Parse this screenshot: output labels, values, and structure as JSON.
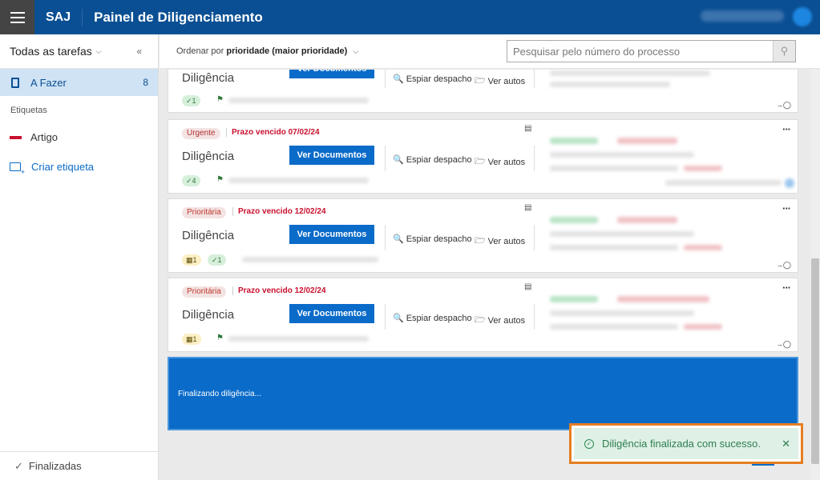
{
  "header": {
    "brand": "SAJ",
    "title": "Painel de Diligenciamento",
    "user_name": "Lorem Ipsum Dolor"
  },
  "sidebar": {
    "filter_label": "Todas as tarefas",
    "active_item": {
      "label": "A Fazer",
      "count": "8"
    },
    "section_label": "Etiquetas",
    "tag": {
      "label": "Artigo",
      "color": "#c8102e"
    },
    "create_label": "Criar etiqueta",
    "footer_label": "Finalizadas"
  },
  "toolbar": {
    "sort_prefix": "Ordenar por",
    "sort_value": "prioridade (maior prioridade)",
    "search_placeholder": "Pesquisar pelo número do processo"
  },
  "cards": [
    {
      "tag": "",
      "deadline": "",
      "title": "Diligência",
      "docs_label": "Ver Documentos",
      "peek_label": "Espiar despacho",
      "autos_label": "Ver autos",
      "badges": [
        "1"
      ]
    },
    {
      "tag": "Urgente",
      "deadline": "Prazo vencido 07/02/24",
      "title": "Diligência",
      "docs_label": "Ver Documentos",
      "peek_label": "Espiar despacho",
      "autos_label": "Ver autos",
      "badges": [
        "4"
      ]
    },
    {
      "tag": "Prioritária",
      "deadline": "Prazo vencido 12/02/24",
      "title": "Diligência",
      "docs_label": "Ver Documentos",
      "peek_label": "Espiar despacho",
      "autos_label": "Ver autos",
      "badges": [
        "1",
        "1"
      ]
    },
    {
      "tag": "Prioritária",
      "deadline": "Prazo vencido 12/02/24",
      "title": "Diligência",
      "docs_label": "Ver Documentos",
      "peek_label": "Espiar despacho",
      "autos_label": "Ver autos",
      "badges": [
        "1"
      ]
    }
  ],
  "finalizing_text": "Finalizando diligência...",
  "toast": {
    "message": "Diligência finalizada com sucesso.",
    "close": "✕"
  },
  "colors": {
    "primary": "#0a4f93",
    "accent": "#0a6bc9",
    "danger": "#c8102e",
    "success": "#2e7d4f",
    "highlight": "#e67e22"
  }
}
